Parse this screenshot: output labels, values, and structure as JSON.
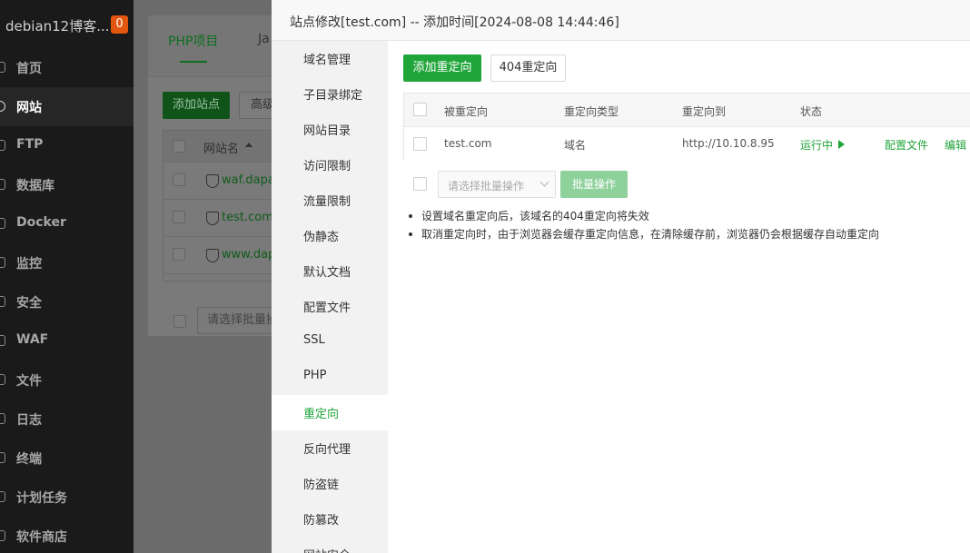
{
  "sidebar": {
    "title": "debian12博客...",
    "badge": "0",
    "items": [
      {
        "label": "首页",
        "icon": "home-icon"
      },
      {
        "label": "网站",
        "icon": "globe-icon"
      },
      {
        "label": "FTP",
        "icon": "ftp-icon"
      },
      {
        "label": "数据库",
        "icon": "database-icon"
      },
      {
        "label": "Docker",
        "icon": "docker-icon"
      },
      {
        "label": "监控",
        "icon": "monitor-icon"
      },
      {
        "label": "安全",
        "icon": "shield-icon"
      },
      {
        "label": "WAF",
        "icon": "waf-icon"
      },
      {
        "label": "文件",
        "icon": "file-icon"
      },
      {
        "label": "日志",
        "icon": "log-icon"
      },
      {
        "label": "终端",
        "icon": "terminal-icon"
      },
      {
        "label": "计划任务",
        "icon": "schedule-icon"
      },
      {
        "label": "软件商店",
        "icon": "store-icon"
      }
    ],
    "active_index": 1
  },
  "background": {
    "tab_php": "PHP项目",
    "tab_java": "Ja",
    "add_site": "添加站点",
    "advanced": "高级",
    "column_site": "网站名",
    "sites": [
      "waf.dapad",
      "test.com",
      "www.dapa"
    ],
    "batch_placeholder": "请选择批量操"
  },
  "modal": {
    "title": "站点修改[test.com] -- 添加时间[2024-08-08 14:44:46]",
    "nav": [
      "域名管理",
      "子目录绑定",
      "网站目录",
      "访问限制",
      "流量限制",
      "伪静态",
      "默认文档",
      "配置文件",
      "SSL",
      "PHP",
      "重定向",
      "反向代理",
      "防盗链",
      "防篡改",
      "网站安全"
    ],
    "nav_active_index": 10,
    "add_redirect": "添加重定向",
    "redirect_404": "404重定向",
    "table": {
      "headers": [
        "被重定向",
        "重定向类型",
        "重定向到",
        "状态"
      ],
      "rows": [
        {
          "source": "test.com",
          "type": "域名",
          "target": "http://10.10.8.95",
          "status": "运行中",
          "config": "配置文件",
          "edit": "编辑"
        }
      ]
    },
    "batch_placeholder": "请选择批量操作",
    "batch_button": "批量操作",
    "tips": [
      "设置域名重定向后，该域名的404重定向将失效",
      "取消重定向时，由于浏览器会缓存重定向信息，在清除缓存前，浏览器仍会根据缓存自动重定向"
    ]
  },
  "colors": {
    "accent": "#20a53a",
    "sidebar_bg": "#1a1a1a",
    "badge": "#e2560f"
  }
}
